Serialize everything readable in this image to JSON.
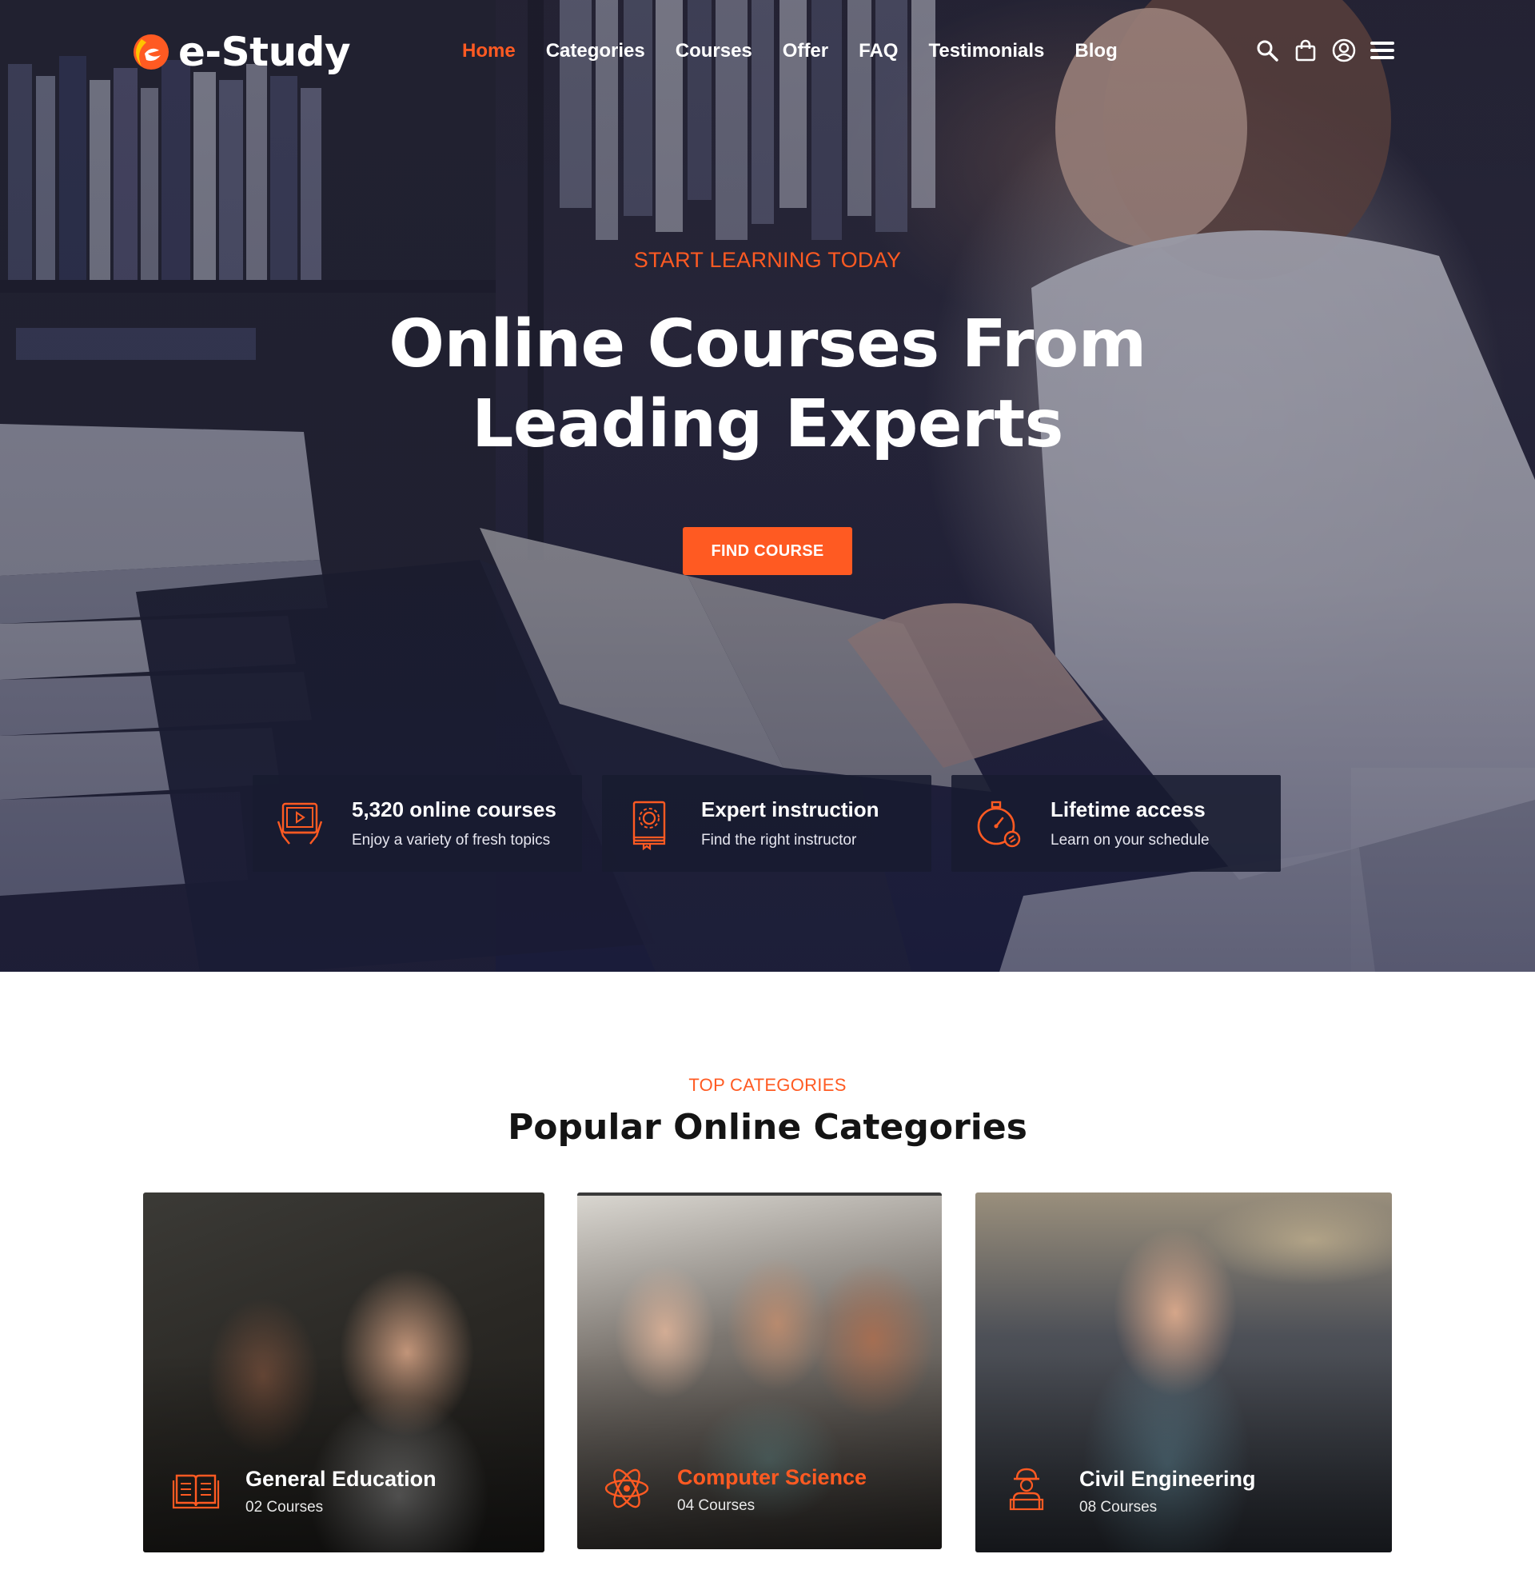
{
  "brand": {
    "name": "e-Study"
  },
  "nav": {
    "items": [
      {
        "label": "Home",
        "active": true
      },
      {
        "label": "Categories"
      },
      {
        "label": "Courses"
      },
      {
        "label": "Offer"
      },
      {
        "label": "FAQ"
      },
      {
        "label": "Testimonials"
      },
      {
        "label": "Blog"
      }
    ],
    "icons": [
      "search-icon",
      "shopping-bag-icon",
      "user-account-icon",
      "hamburger-menu-icon"
    ]
  },
  "hero": {
    "eyebrow": "START LEARNING TODAY",
    "title_line1": "Online Courses From",
    "title_line2": "Leading Experts",
    "cta_label": "FIND COURSE"
  },
  "features": [
    {
      "icon": "video-tablet-icon",
      "title": "5,320 online courses",
      "subtitle": "Enjoy a variety of fresh topics"
    },
    {
      "icon": "certificate-gear-icon",
      "title": "Expert instruction",
      "subtitle": "Find the right instructor"
    },
    {
      "icon": "stopwatch-icon",
      "title": "Lifetime access",
      "subtitle": "Learn on your schedule"
    }
  ],
  "categories": {
    "eyebrow": "TOP CATEGORIES",
    "title": "Popular Online Categories",
    "items": [
      {
        "icon": "open-book-icon",
        "title": "General Education",
        "count": "02 Courses"
      },
      {
        "icon": "atom-icon",
        "title": "Computer Science",
        "count": "04 Courses"
      },
      {
        "icon": "engineer-icon",
        "title": "Civil Engineering",
        "count": "08 Courses"
      }
    ]
  },
  "colors": {
    "accent": "#ff5a22",
    "dark_panel": "#181b30",
    "heading": "#141414"
  }
}
